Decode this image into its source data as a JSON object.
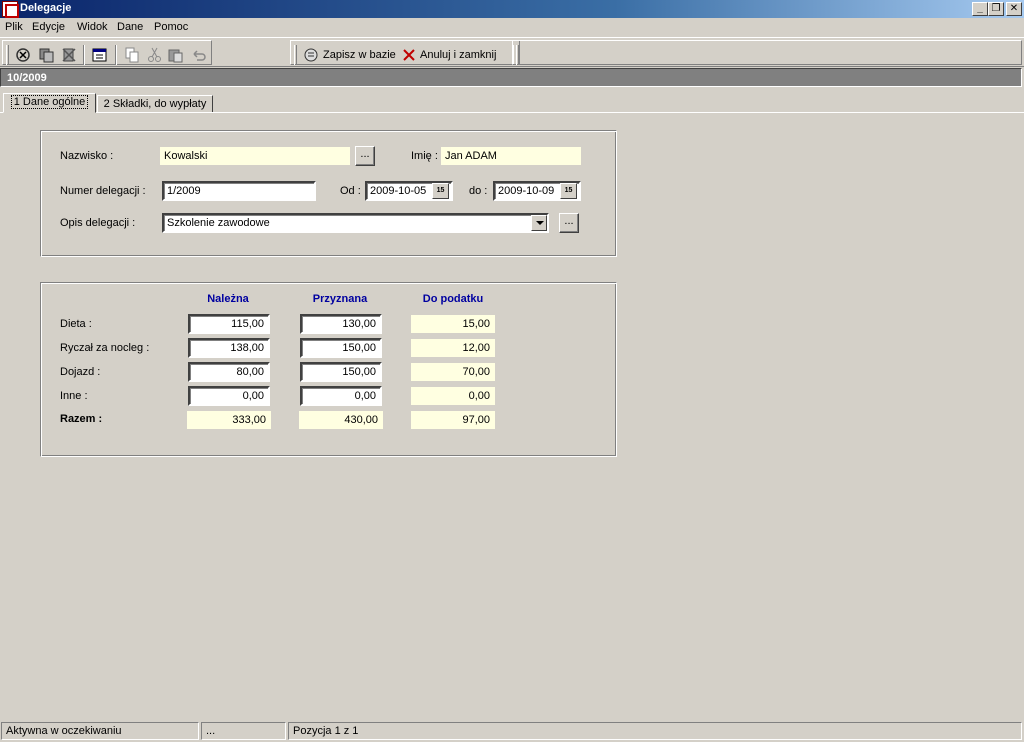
{
  "window": {
    "title": "Delegacje"
  },
  "menu": [
    "Plik",
    "Edycje",
    "Widok",
    "Dane",
    "Pomoc"
  ],
  "toolbar": {
    "save_label": "Zapisz w bazie",
    "cancel_label": "Anuluj i zamknij"
  },
  "record": {
    "title": "10/2009"
  },
  "tabs": [
    {
      "label": "1 Dane ogólne",
      "active": true
    },
    {
      "label": "2 Składki, do wypłaty",
      "active": false
    }
  ],
  "form": {
    "nazwisko_label": "Nazwisko :",
    "nazwisko_value": "Kowalski",
    "imie_label": "Imię :",
    "imie_value": "Jan ADAM",
    "numer_label": "Numer delegacji :",
    "numer_value": "1/2009",
    "od_label": "Od :",
    "od_value": "2009-10-05",
    "do_label": "do :",
    "do_value": "2009-10-09",
    "opis_label": "Opis delegacji :",
    "opis_value": "Szkolenie zawodowe",
    "ellipsis": "...",
    "calendar_glyph": "15"
  },
  "amounts": {
    "headers": [
      "Należna",
      "Przyznana",
      "Do podatku"
    ],
    "rows": [
      {
        "label": "Dieta :",
        "nalezna": "115,00",
        "przyznana": "130,00",
        "do_podatku": "15,00"
      },
      {
        "label": "Ryczał za nocleg :",
        "nalezna": "138,00",
        "przyznana": "150,00",
        "do_podatku": "12,00"
      },
      {
        "label": "Dojazd :",
        "nalezna": "80,00",
        "przyznana": "150,00",
        "do_podatku": "70,00"
      },
      {
        "label": "Inne :",
        "nalezna": "0,00",
        "przyznana": "0,00",
        "do_podatku": "0,00"
      }
    ],
    "total": {
      "label": "Razem :",
      "nalezna": "333,00",
      "przyznana": "430,00",
      "do_podatku": "97,00"
    }
  },
  "status": {
    "state": "Aktywna w oczekiwaniu",
    "middle": "...",
    "position": "Pozycja 1 z 1"
  }
}
